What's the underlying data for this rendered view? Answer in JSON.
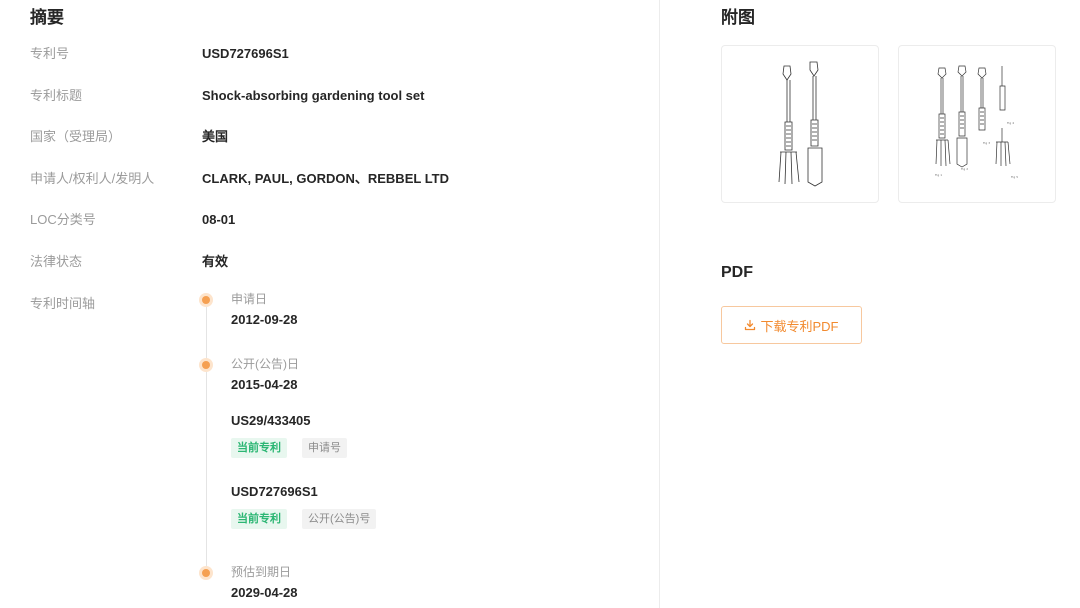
{
  "summary": {
    "title": "摘要",
    "fields": [
      {
        "label": "专利号",
        "value": "USD727696S1"
      },
      {
        "label": "专利标题",
        "value": "Shock-absorbing gardening tool set"
      },
      {
        "label": "国家（受理局）",
        "value": "美国"
      },
      {
        "label": "申请人/权利人/发明人",
        "value": "CLARK, PAUL, GORDON、REBBEL LTD"
      },
      {
        "label": "LOC分类号",
        "value": "08-01"
      },
      {
        "label": "法律状态",
        "value": "有效"
      }
    ],
    "timeline_label": "专利时间轴",
    "timeline": {
      "filing": {
        "label": "申请日",
        "date": "2012-09-28"
      },
      "publication": {
        "label": "公开(公告)日",
        "date": "2015-04-28"
      },
      "application_number": {
        "number": "US29/433405",
        "tag_current": "当前专利",
        "tag_type": "申请号"
      },
      "publication_number": {
        "number": "USD727696S1",
        "tag_current": "当前专利",
        "tag_type": "公开(公告)号"
      },
      "expiry": {
        "label": "预估到期日",
        "date": "2029-04-28"
      }
    }
  },
  "figures": {
    "title": "附图",
    "items": [
      "figure-1-two-tools",
      "figure-2-tool-set"
    ]
  },
  "pdf": {
    "title": "PDF",
    "download_label": "下载专利PDF",
    "icon": "download-icon"
  },
  "colors": {
    "accent_orange": "#f28a2f",
    "timeline_dot": "#f5a052",
    "tag_green": "#2bb673",
    "label_gray": "#9b9b9b"
  }
}
